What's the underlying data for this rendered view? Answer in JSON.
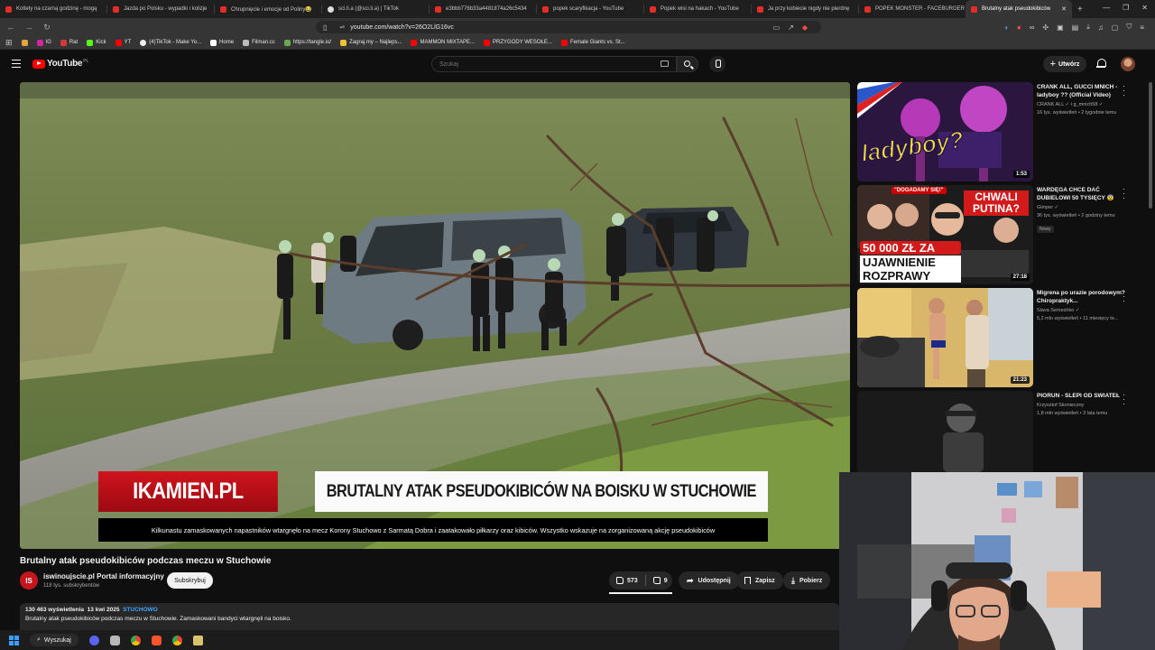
{
  "browser": {
    "tabs": [
      {
        "label": "Kotlety na czarną godzinę - mogą",
        "icon": "youtube-icon"
      },
      {
        "label": "Jazda po Polsku - wypadki i kolizje",
        "icon": "youtube-icon"
      },
      {
        "label": "Chrupnięcie i emocje od Poliny😂",
        "icon": "youtube-icon"
      },
      {
        "label": "sci.li.a (@sci.li.a) | TikTok",
        "icon": "tiktok-icon"
      },
      {
        "label": "e3bbb776b33a4481874a26c5434",
        "icon": "youtube-icon"
      },
      {
        "label": "popek scaryfikacja - YouTube",
        "icon": "youtube-icon"
      },
      {
        "label": "Popek wisi na hakach - YouTube",
        "icon": "youtube-icon"
      },
      {
        "label": "Ja przy kobiecie nigdy nie pierdnę",
        "icon": "youtube-icon"
      },
      {
        "label": "POPEK MONSTER - FACEBURGER",
        "icon": "youtube-icon"
      },
      {
        "label": "Brutalny atak pseudokibiców",
        "icon": "youtube-icon",
        "active": true
      }
    ],
    "url": "youtube.com/watch?v=26O2LlG16vc",
    "bookmarks": [
      "IG",
      "Rat",
      "Kick",
      "YT",
      "(4)TikTok - Make Yo...",
      "Home",
      "Filman.cc",
      "https://tangle.io/",
      "Zagraj.my – Najleps...",
      "MAMMON MIXTAPE...",
      "PRZYGODY WESOŁE...",
      "Female Giants vs. St..."
    ]
  },
  "header": {
    "logo_text": "YouTube",
    "country_code": "PL",
    "search_placeholder": "Szukaj",
    "create_label": "Utwórz"
  },
  "video": {
    "overlay_brand": "IKAMIEN.PL",
    "overlay_headline": "BRUTALNY ATAK PSEUDOKIBICÓW NA BOISKU W STUCHOWIE",
    "overlay_ticker": "Kilkunastu zamaskowanych napastników wtargnęło na mecz Korony Stuchowo z Sarmatą Dobra i zaatakowało piłkarzy oraz kibiców. Wszystko wskazuje na zorganizowaną akcję pseudokibiców",
    "title": "Brutalny atak pseudokibiców podczas meczu w Stuchowie",
    "channel_initials": "IS",
    "channel_name": "iswinoujscie.pl Portal informacyjny",
    "subscribers": "118 tys. subskrybentów",
    "subscribe_label": "Subskrybuj",
    "likes": "573",
    "dislikes": "9",
    "share_label": "Udostępnij",
    "save_label": "Zapisz",
    "download_label": "Pobierz",
    "views": "130 463 wyświetlenia",
    "date": "13 kwi 2025",
    "hashtag": "STUCHOWO",
    "description": "Brutalny atak pseudokibiców podczas meczu w Stuchowie. Zamaskowani bandyci wtargnęli na boisko."
  },
  "recommendations": [
    {
      "title": "CRANK ALL, GUCCI MNICH - ladyboy ?? (Official Video)",
      "channel": "CRANK ALL ✓ i g_mnich58 ✓",
      "meta": "16 tys. wyświetleń • 2 tygodnie temu",
      "duration": "1:53",
      "badge": ""
    },
    {
      "title": "WARDĘGA CHCE DAĆ DUBIELOWI 50 TYSIĘCY 😨",
      "channel": "Gimper ✓",
      "meta": "36 tys. wyświetleń • 2 godziny temu",
      "duration": "27:18",
      "badge": "Nowy"
    },
    {
      "title": "Migrena po urazie porodowym? Chiropraktyk...",
      "channel": "Slava Semeshko ✓",
      "meta": "5,2 mln wyświetleń • 11 miesięcy te...",
      "duration": "21:23",
      "badge": ""
    },
    {
      "title": "PIORUN - SLEPI OD SWIATEŁ",
      "channel": "Krzysztof Skonieczny",
      "meta": "1,8 mln wyświetleń • 3 lata temu",
      "duration": "",
      "badge": ""
    }
  ],
  "thumb_text": {
    "t1": "ladyboy?",
    "t2_a": "\"DOGADAMY SIĘ!\"",
    "t2_b": "CHWALI PUTINA?",
    "t2_c": "50 000 ZŁ ZA",
    "t2_d": "UJAWNIENIE",
    "t2_e": "ROZPRAWY"
  },
  "taskbar": {
    "search_label": "Wyszukaj"
  },
  "colors": {
    "yt_red": "#ff0000",
    "background": "#0f0f0f",
    "link_blue": "#3ea6ff",
    "overlay_red": "#d0141d"
  }
}
